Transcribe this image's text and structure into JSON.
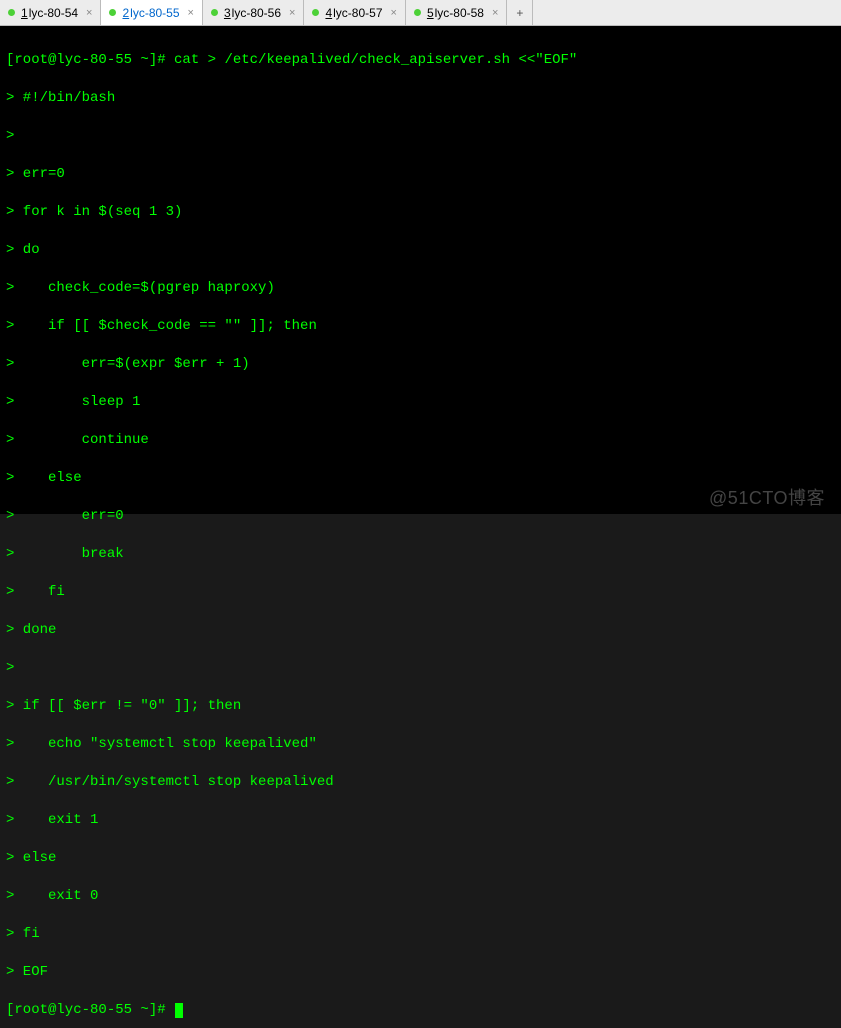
{
  "tabs": [
    {
      "num": "1",
      "label": "lyc-80-54",
      "active": false
    },
    {
      "num": "2",
      "label": "lyc-80-55",
      "active": true
    },
    {
      "num": "3",
      "label": "lyc-80-56",
      "active": false
    },
    {
      "num": "4",
      "label": "lyc-80-57",
      "active": false
    },
    {
      "num": "5",
      "label": "lyc-80-58",
      "active": false
    }
  ],
  "add_tab_label": "+",
  "prompt1": "[root@lyc-80-55 ~]# ",
  "command": "cat > /etc/keepalived/check_apiserver.sh <<\"EOF\"",
  "lines": [
    "> #!/bin/bash",
    ">",
    "> err=0",
    "> for k in $(seq 1 3)",
    "> do",
    ">    check_code=$(pgrep haproxy)",
    ">    if [[ $check_code == \"\" ]]; then",
    ">        err=$(expr $err + 1)",
    ">        sleep 1",
    ">        continue",
    ">    else",
    ">        err=0",
    ">        break",
    ">    fi",
    "> done",
    ">",
    "> if [[ $err != \"0\" ]]; then",
    ">    echo \"systemctl stop keepalived\"",
    ">    /usr/bin/systemctl stop keepalived",
    ">    exit 1",
    "> else",
    ">    exit 0",
    "> fi",
    "> EOF"
  ],
  "prompt2": "[root@lyc-80-55 ~]# ",
  "watermark": "@51CTO博客"
}
